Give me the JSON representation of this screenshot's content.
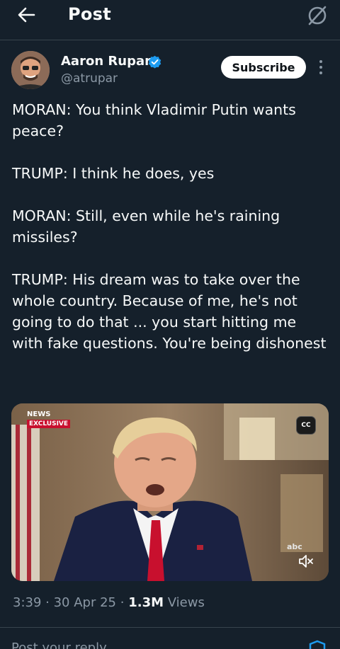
{
  "header": {
    "title": "Post"
  },
  "author": {
    "name": "Aaron Rupar",
    "handle": "@atrupar",
    "subscribe_label": "Subscribe"
  },
  "tweet": {
    "paragraphs": [
      "MORAN: You think Vladimir Putin wants peace?",
      "TRUMP: I think he does, yes",
      "MORAN: Still, even while he's raining missiles?",
      "TRUMP: His dream was to take over the whole country. Because of me, he's not going to do that ... you start hitting me with fake questions. You're being dishonest"
    ]
  },
  "video": {
    "network_label": "NEWS",
    "badge": "EXCLUSIVE",
    "cc_label": "CC",
    "watermark": "abc"
  },
  "meta": {
    "time": "3:39",
    "date": "30 Apr 25",
    "views_count": "1.3M",
    "views_label": "Views"
  },
  "footer": {
    "partial_text": "Post your reply"
  },
  "colors": {
    "background": "#15202b",
    "verified": "#1d9bf0",
    "secondary_text": "#8b98a5"
  }
}
